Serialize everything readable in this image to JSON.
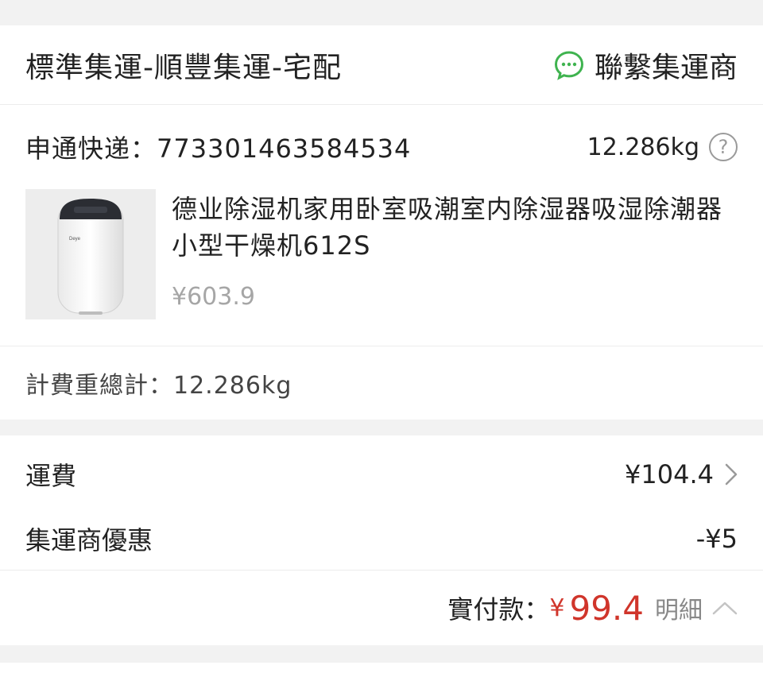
{
  "shipping": {
    "method": "標準集運-順豐集運-宅配",
    "contact_label": "聯繫集運商"
  },
  "package": {
    "tracking": "申通快递：773301463584534",
    "weight": "12.286kg",
    "help_icon": "?",
    "product_name": "德业除湿机家用卧室吸潮室内除湿器吸湿除潮器小型干燥机612S",
    "product_price": "¥603.9",
    "weight_total": "計費重總計：12.286kg"
  },
  "fees": {
    "freight_label": "運費",
    "freight_value": "¥104.4",
    "discount_label": "集運商優惠",
    "discount_value": "-¥5"
  },
  "total": {
    "label": "實付款：",
    "currency": "¥",
    "amount": "99.4",
    "detail_label": "明細"
  },
  "colors": {
    "accent_red": "#d0352b",
    "wechat_green": "#3fb34f"
  },
  "icons": {
    "contact": "chat-bubble-icon",
    "help": "question-circle-icon",
    "freight_more": "chevron-right-icon",
    "detail_toggle": "chevron-up-icon"
  }
}
